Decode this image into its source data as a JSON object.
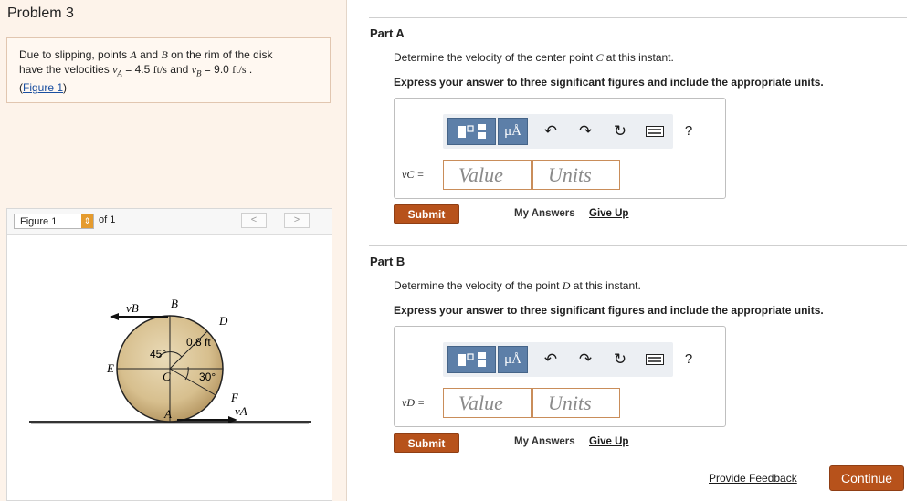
{
  "problem": {
    "title": "Problem 3",
    "text": {
      "p1": "Due to slipping, points ",
      "A": "A",
      "p2": " and ",
      "B": "B",
      "p3": " on the rim of the disk",
      "p4": "have the velocities ",
      "vA": "v",
      "vA_sub": "A",
      "p5": " = 4.5 ",
      "u1": "ft/s",
      "p6": " and ",
      "vB": "v",
      "vB_sub": "B",
      "p7": " = 9.0 ",
      "u2": "ft/s",
      "p8": " .",
      "link_open": "(",
      "link": "Figure 1",
      "link_close": ")"
    }
  },
  "figure": {
    "select_label": "Figure 1",
    "of_text": "of 1",
    "prev": "<",
    "next": ">",
    "labels": {
      "vB": "vB",
      "B": "B",
      "D": "D",
      "dist": "0.8 ft",
      "angle45": "45°",
      "E": "E",
      "C": "C",
      "angle30": "30°",
      "F": "F",
      "vA": "vA",
      "A": "A"
    }
  },
  "partA": {
    "title": "Part A",
    "question_pre": "Determine the velocity of the center point ",
    "question_var": "C",
    "question_post": " at this instant.",
    "instruction": "Express your answer to three significant figures and include the appropriate units.",
    "answer_label": "vC =",
    "value_placeholder": "Value",
    "units_placeholder": "Units",
    "submit": "Submit",
    "my_answers": "My Answers",
    "give_up": "Give Up"
  },
  "partB": {
    "title": "Part B",
    "question_pre": "Determine the velocity of the point ",
    "question_var": "D",
    "question_post": " at this instant.",
    "instruction": "Express your answer to three significant figures and include the appropriate units.",
    "answer_label": "vD =",
    "value_placeholder": "Value",
    "units_placeholder": "Units",
    "submit": "Submit",
    "my_answers": "My Answers",
    "give_up": "Give Up"
  },
  "toolbar": {
    "mu_label": "μÅ",
    "icons": [
      "templates-icon",
      "units-icon",
      "undo-icon",
      "redo-icon",
      "reset-icon",
      "keyboard-icon",
      "help-icon"
    ],
    "help": "?"
  },
  "footer": {
    "feedback": "Provide Feedback",
    "continue": "Continue"
  },
  "colors": {
    "accent": "#b7521b",
    "toolbar_button": "#5d7fa8",
    "left_panel": "#fdf3ea",
    "select_arrow": "#e59b2d"
  }
}
